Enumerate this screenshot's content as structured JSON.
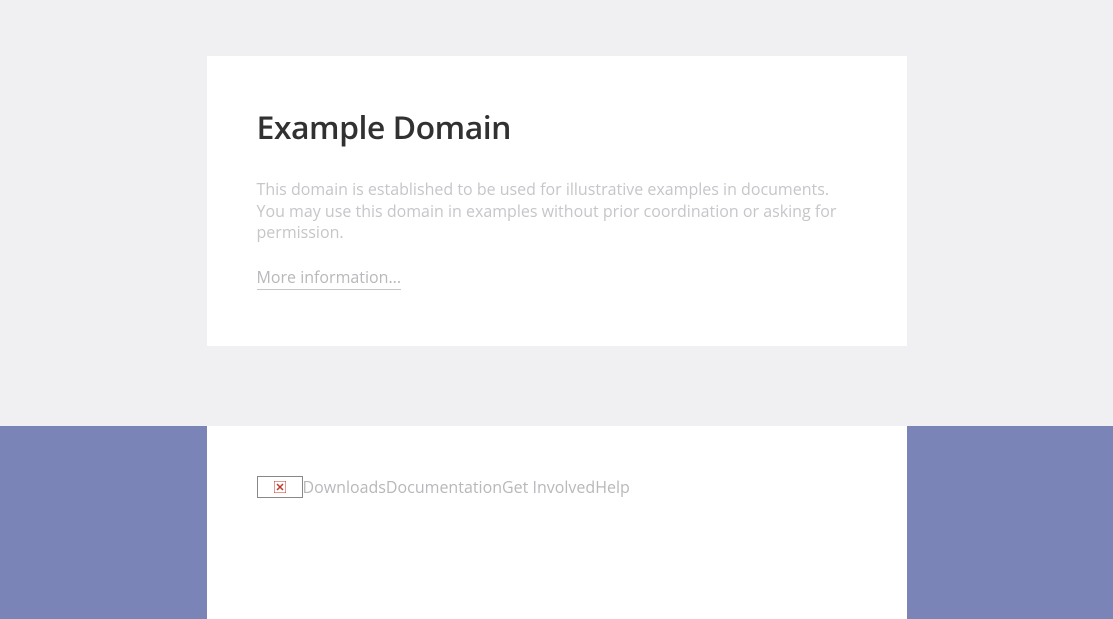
{
  "main": {
    "title": "Example Domain",
    "description": "This domain is established to be used for illustrative examples in documents. You may use this domain in examples without prior coordination or asking for permission.",
    "more_link": "More information..."
  },
  "footer": {
    "links": {
      "downloads": "Downloads",
      "documentation": "Documentation",
      "get_involved": "Get Involved",
      "help": "Help"
    }
  }
}
